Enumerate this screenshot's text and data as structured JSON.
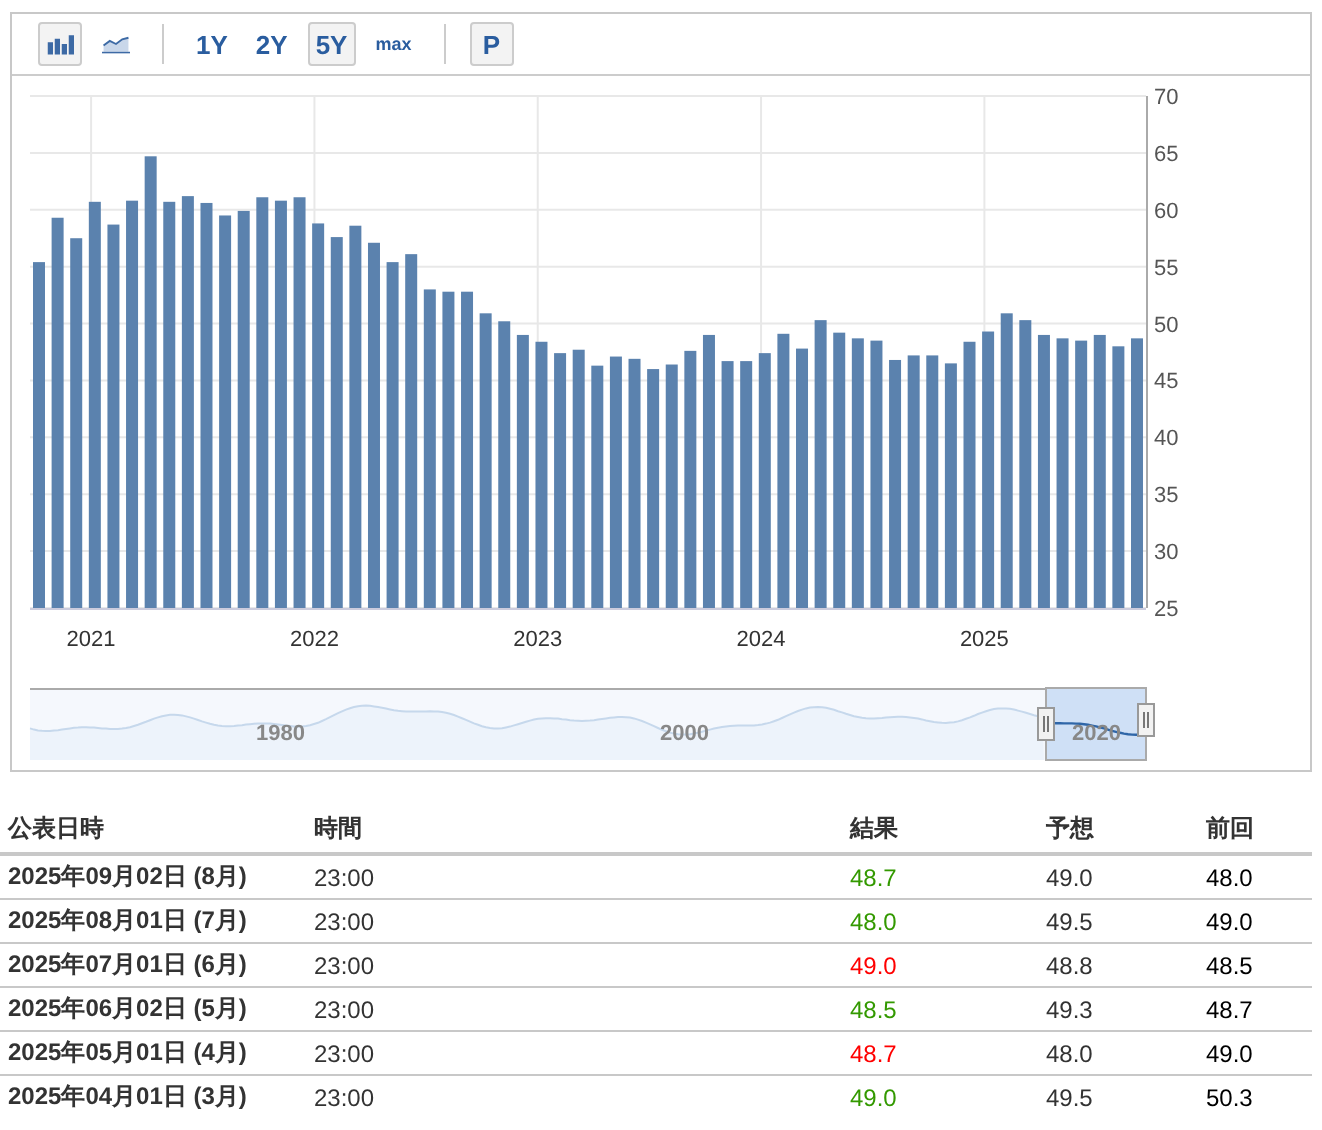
{
  "toolbar": {
    "chart_types": [
      {
        "kind": "bar",
        "selected": true
      },
      {
        "kind": "area",
        "selected": false
      }
    ],
    "ranges": [
      {
        "label": "1Y",
        "selected": false
      },
      {
        "label": "2Y",
        "selected": false
      },
      {
        "label": "5Y",
        "selected": true
      },
      {
        "label": "max",
        "selected": false
      }
    ],
    "print_button": "P"
  },
  "chart": {
    "chart_data": {
      "type": "bar",
      "series": [
        {
          "color": "#5b82ae",
          "values": [
            55.4,
            59.3,
            57.5,
            60.7,
            58.7,
            60.8,
            64.7,
            60.7,
            61.2,
            60.6,
            59.5,
            59.9,
            61.1,
            60.8,
            61.1,
            58.8,
            57.6,
            58.6,
            57.1,
            55.4,
            56.1,
            53.0,
            52.8,
            52.8,
            50.9,
            50.2,
            49.0,
            48.4,
            47.4,
            47.7,
            46.3,
            47.1,
            46.9,
            46.0,
            46.4,
            47.6,
            49.0,
            46.7,
            46.7,
            47.4,
            49.1,
            47.8,
            50.3,
            49.2,
            48.7,
            48.5,
            46.8,
            47.2,
            47.2,
            46.5,
            48.4,
            49.3,
            50.9,
            50.3,
            49.0,
            48.7,
            48.5,
            49.0,
            48.0,
            48.7
          ]
        }
      ],
      "ylim": [
        25,
        70
      ],
      "yticks": [
        25,
        30,
        35,
        40,
        45,
        50,
        55,
        60,
        65,
        70
      ],
      "grid": true
    },
    "x_axis_labels": [
      "2021",
      "2022",
      "2023",
      "2024",
      "2025"
    ]
  },
  "navigator": {
    "labels": [
      "1980",
      "2000",
      "2020"
    ]
  },
  "table": {
    "columns": [
      "公表日時",
      "時間",
      "結果",
      "予想",
      "前回"
    ],
    "rows": [
      {
        "date": "2025年09月02日 (8月)",
        "time": "23:00",
        "actual": "48.7",
        "color": "#339900",
        "forecast": "49.0",
        "previous": "48.0"
      },
      {
        "date": "2025年08月01日 (7月)",
        "time": "23:00",
        "actual": "48.0",
        "color": "#339900",
        "forecast": "49.5",
        "previous": "49.0"
      },
      {
        "date": "2025年07月01日 (6月)",
        "time": "23:00",
        "actual": "49.0",
        "color": "#ff0000",
        "forecast": "48.8",
        "previous": "48.5"
      },
      {
        "date": "2025年06月02日 (5月)",
        "time": "23:00",
        "actual": "48.5",
        "color": "#339900",
        "forecast": "49.3",
        "previous": "48.7"
      },
      {
        "date": "2025年05月01日 (4月)",
        "time": "23:00",
        "actual": "48.7",
        "color": "#ff0000",
        "forecast": "48.0",
        "previous": "49.0"
      },
      {
        "date": "2025年04月01日 (3月)",
        "time": "23:00",
        "actual": "49.0",
        "color": "#339900",
        "forecast": "49.5",
        "previous": "50.3"
      }
    ]
  }
}
